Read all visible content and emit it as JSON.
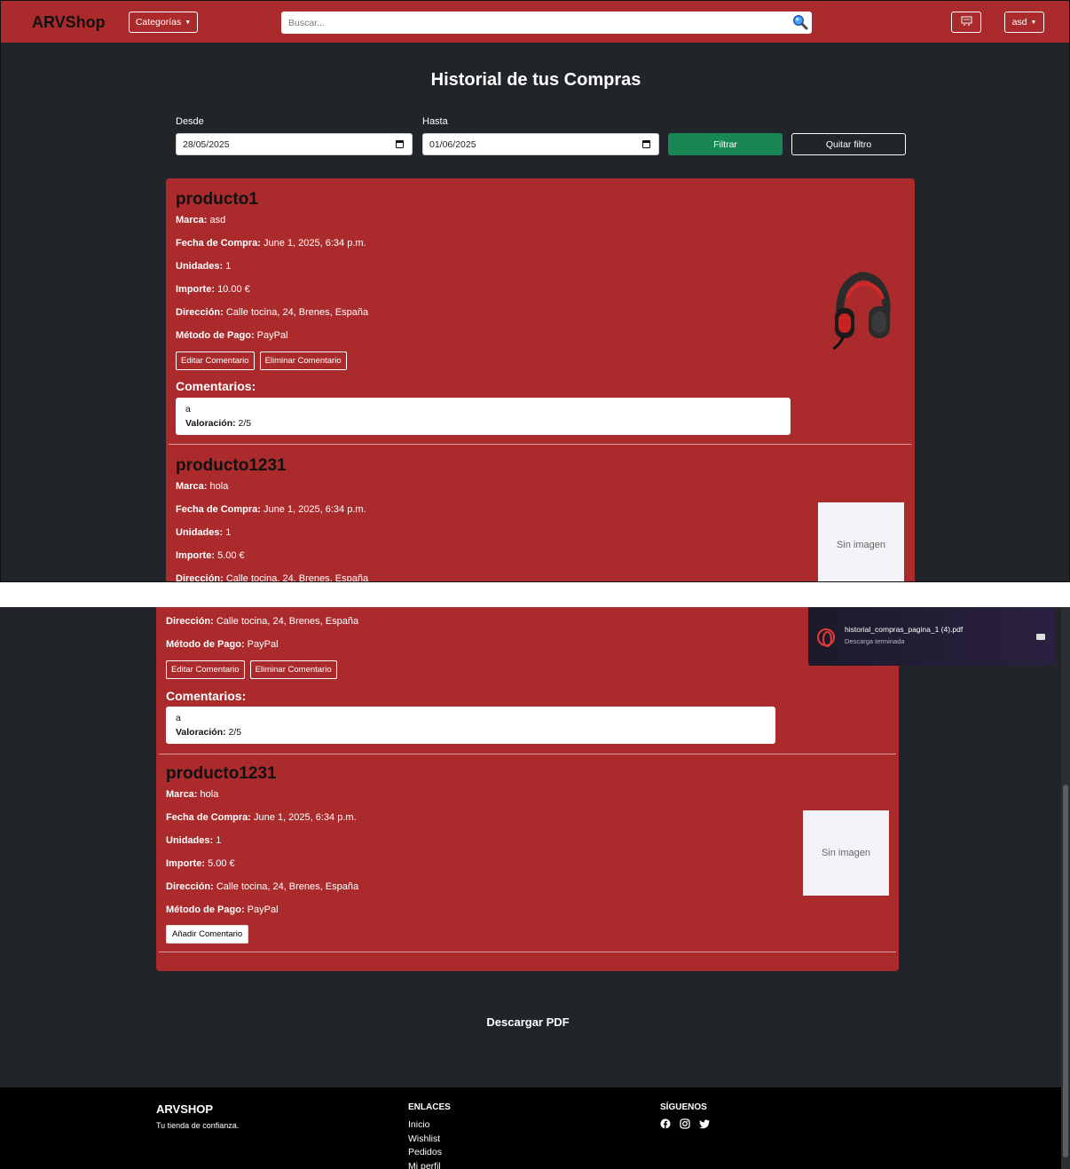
{
  "navbar": {
    "brand": "ARVShop",
    "categories_label": "Categorías",
    "search_placeholder": "Buscar...",
    "user_label": "asd"
  },
  "page": {
    "title": "Historial de tus Compras"
  },
  "filter": {
    "desde_label": "Desde",
    "desde_value": "28/05/2025",
    "hasta_label": "Hasta",
    "hasta_value": "01/06/2025",
    "filtrar_label": "Filtrar",
    "quitar_label": "Quitar filtro"
  },
  "labels": {
    "marca": "Marca:",
    "fecha": "Fecha de Compra:",
    "unidades": "Unidades:",
    "importe": "Importe:",
    "direccion": "Dirección:",
    "metodo": "Método de Pago:",
    "comentarios": "Comentarios:",
    "valoracion": "Valoración:",
    "editar_comentario": "Editar Comentario",
    "eliminar_comentario": "Eliminar Comentario",
    "anadir_comentario": "Añadir Comentario",
    "sin_imagen": "Sin imagen"
  },
  "purchases": [
    {
      "name": "producto1",
      "marca": "asd",
      "fecha": "June 1, 2025, 6:34 p.m.",
      "unidades": "1",
      "importe": "10.00 €",
      "direccion": "Calle tocina, 24, Brenes, España",
      "metodo": "PayPal",
      "image": "headset",
      "comment_text": "a",
      "valoracion": "2/5"
    },
    {
      "name": "producto1231",
      "marca": "hola",
      "fecha": "June 1, 2025, 6:34 p.m.",
      "unidades": "1",
      "importe": "5.00 €",
      "direccion": "Calle tocina, 24, Brenes, España",
      "metodo": "PayPal",
      "image": "none"
    }
  ],
  "download": {
    "filename": "historial_compras_pagina_1 (4).pdf",
    "status": "Descarga terminada"
  },
  "pdf_link": "Descargar PDF",
  "footer": {
    "brand": "ARVSHOP",
    "tagline": "Tu tienda de confianza.",
    "links_heading": "ENLACES",
    "links": [
      "Inicio",
      "Wishlist",
      "Pedidos",
      "Mi perfil"
    ],
    "social_heading": "SÍGUENOS",
    "social_icons": [
      "facebook-icon",
      "instagram-icon",
      "twitter-icon"
    ]
  },
  "colors": {
    "navbar": "#ab2b2d",
    "background": "#212529",
    "card": "#ab2b2d",
    "filtrar_button": "#198754",
    "footer": "#000000"
  }
}
